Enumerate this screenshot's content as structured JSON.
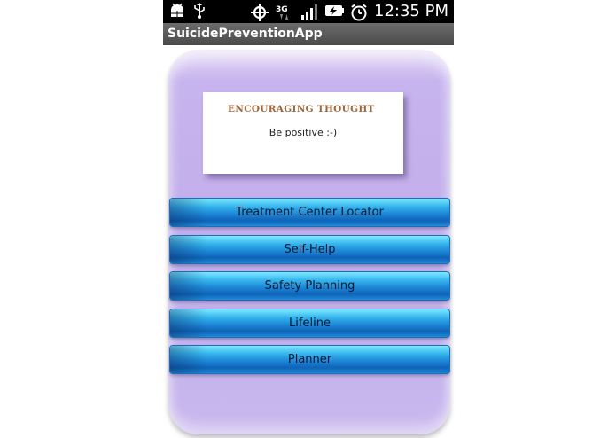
{
  "status_bar": {
    "time": "12:35 PM",
    "network": "3G",
    "icons": [
      "android-debug-icon",
      "usb-icon",
      "gps-icon",
      "network-3g-icon",
      "signal-icon",
      "battery-charging-icon",
      "alarm-clock-icon"
    ]
  },
  "app": {
    "title": "SuicidePreventionApp"
  },
  "thought_card": {
    "heading": "ENCOURAGING THOUGHT",
    "text": "Be positive :-)"
  },
  "menu": {
    "buttons": [
      {
        "label": "Treatment Center Locator"
      },
      {
        "label": "Self-Help"
      },
      {
        "label": "Safety Planning"
      },
      {
        "label": "Lifeline"
      },
      {
        "label": "Planner"
      }
    ]
  },
  "colors": {
    "status_bar_bg": "#000000",
    "title_bar_bg": "#5a5a5a",
    "card_bg": "#c1ade9",
    "button_blue": "#1d87d6",
    "heading_brown": "#a0683a"
  }
}
